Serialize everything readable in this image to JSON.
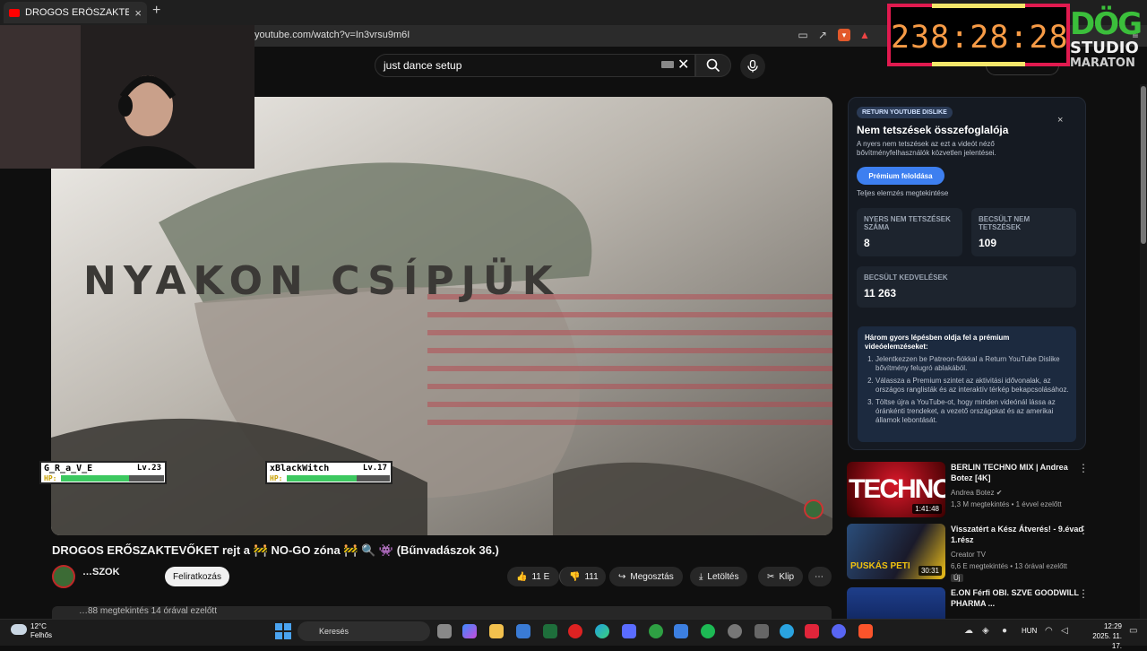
{
  "browser": {
    "tab_title": "DROGOS ERŐSZAKTEVŐKET rejt",
    "new_tab": "+",
    "tab_close": "×",
    "url": "youtube.com/watch?v=In3vrsu9m6I"
  },
  "search": {
    "query": "just dance setup",
    "clear": "✕"
  },
  "video": {
    "overlay_text": "NYAKON CSÍPJÜK",
    "title": "DROGOS ERŐSZAKTEVŐKET rejt a 🚧 NO-GO zóna 🚧 🔍 👾 (Bűnvadászok 36.)",
    "channel_partial": "…SZOK",
    "subscribe": "Feliratkozás",
    "likes": "11 E",
    "dislikes": "111",
    "share": "Megosztás",
    "download": "Letöltés",
    "clip": "Klip",
    "more": "⋯",
    "desc_meta": "…88 megtekintés  14 órával ezelőtt"
  },
  "overlay": {
    "timer": "238:28:28",
    "logo_line1": "DÖG",
    "logo_line2": "STUDIO",
    "logo_line3": "MARATON"
  },
  "players": [
    {
      "name": "G_R_a_V_E",
      "level": "Lv.23",
      "hp_label": "HP:",
      "hp": 0.66
    },
    {
      "name": "xBlackWitch",
      "level": "Lv.17",
      "hp_label": "HP:",
      "hp": 0.68
    }
  ],
  "ryd": {
    "badge": "RETURN YOUTUBE DISLIKE",
    "close": "×",
    "title": "Nem tetszések összefoglalója",
    "desc": "A nyers nem tetszések az ezt a videót néző bővítményfelhasználók közvetlen jelentései.",
    "premium_btn": "Prémium feloldása",
    "full_link": "Teljes elemzés megtekintése",
    "raw_label": "NYERS NEM TETSZÉSEK SZÁMA",
    "raw_value": "8",
    "est_dislike_label": "BECSÜLT NEM TETSZÉSEK",
    "est_dislike_value": "109",
    "est_like_label": "BECSÜLT KEDVELÉSEK",
    "est_like_value": "11 263",
    "steps_title": "Három gyors lépésben oldja fel a prémium videóelemzéseket:",
    "steps": [
      "Jelentkezzen be Patreon-fiókkal a Return YouTube Dislike bővítmény felugró ablakából.",
      "Válassza a Premium szintet az aktivitási idővonalak, az országos ranglisták és az interaktív térkép bekapcsolásához.",
      "Töltse újra a YouTube-ot, hogy minden videónál lássa az óránkénti trendeket, a vezető országokat és az amerikai államok lebontását."
    ]
  },
  "recommendations": [
    {
      "title": "BERLIN TECHNO MIX | Andrea Botez [4K]",
      "channel": "Andrea Botez ✔",
      "meta": "1,3 M megtekintés • 1 évvel ezelőtt",
      "duration": "1:41:48",
      "thumb_text": "TECHNO"
    },
    {
      "title": "Visszatért a Kész Átverés! - 9.évad 1.rész",
      "channel": "Creator TV",
      "meta": "6,6 E megtekintés • 13 órával ezelőtt",
      "badge": "Új",
      "duration": "30:31",
      "thumb_text": "PUSKÁS PETI"
    },
    {
      "title": "E.ON Férfi OBI.  SZVE GOODWILL PHARMA ...",
      "channel": "",
      "meta": "",
      "duration": "",
      "thumb_text": ""
    }
  ],
  "taskbar": {
    "temp": "12°C",
    "weather": "Felhős",
    "search": "Keresés",
    "lang": "HUN",
    "time": "12:29",
    "date": "2025. 11. 17."
  }
}
